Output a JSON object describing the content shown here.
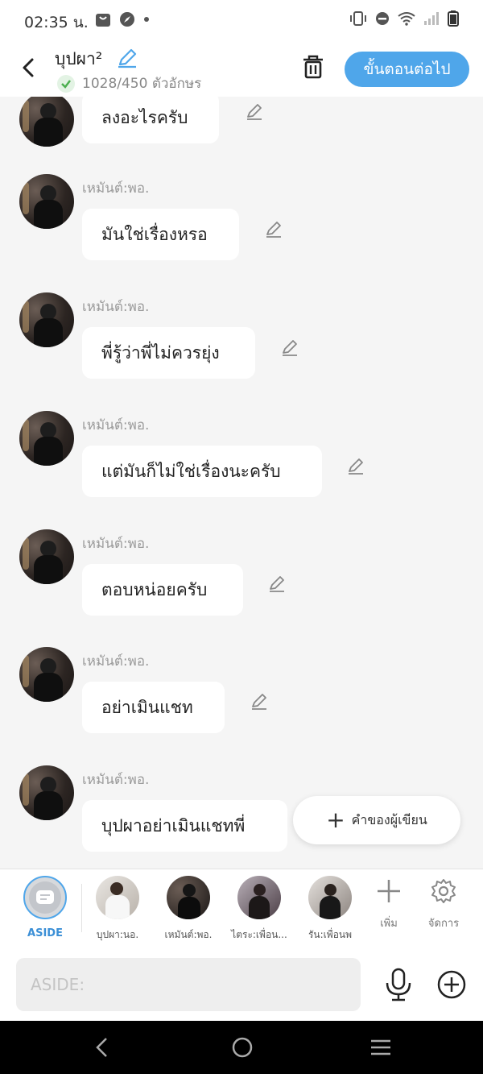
{
  "status": {
    "time": "02:35 น."
  },
  "header": {
    "title": "บุปผา²",
    "char_count": "1028/450 ตัวอักษร",
    "next_label": "ขั้นตอนต่อไป"
  },
  "messages": [
    {
      "sender": "",
      "text": "ลงอะไรครับ"
    },
    {
      "sender": "เหมันต์:พอ.",
      "text": "มันใช่เรื่องหรอ"
    },
    {
      "sender": "เหมันต์:พอ.",
      "text": "พี่รู้ว่าพี่ไม่ควรยุ่ง"
    },
    {
      "sender": "เหมันต์:พอ.",
      "text": "แต่มันก็ไม่ใช่เรื่องนะครับ"
    },
    {
      "sender": "เหมันต์:พอ.",
      "text": "ตอบหน่อยครับ"
    },
    {
      "sender": "เหมันต์:พอ.",
      "text": "อย่าเมินแชท"
    },
    {
      "sender": "เหมันต์:พอ.",
      "text": "บุปผาอย่าเมินแชทพี่"
    }
  ],
  "author_button": "คำของผู้เขียน",
  "characters": {
    "aside_label": "ASIDE",
    "list": [
      {
        "label": "บุปผา:นอ."
      },
      {
        "label": "เหมันต์:พอ."
      },
      {
        "label": "ไตระ:เพื่อน..."
      },
      {
        "label": "รัน:เพื่อนพ"
      }
    ],
    "add_label": "เพิ่ม",
    "manage_label": "จัดการ"
  },
  "input": {
    "placeholder": "ASIDE:"
  },
  "colors": {
    "accent": "#4fa6ea",
    "check": "#4caf50"
  }
}
